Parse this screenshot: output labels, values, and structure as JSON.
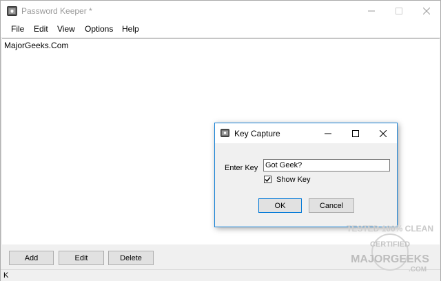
{
  "window": {
    "title": "Password Keeper *"
  },
  "menu": [
    "File",
    "Edit",
    "View",
    "Options",
    "Help"
  ],
  "text_area": {
    "content": "MajorGeeks.Com"
  },
  "bottom_buttons": {
    "add": "Add",
    "edit": "Edit",
    "delete": "Delete"
  },
  "status_bar": {
    "text": "K"
  },
  "dialog": {
    "title": "Key Capture",
    "enter_key_label": "Enter Key",
    "key_value": "Got Geek?",
    "show_key_label": "Show Key",
    "show_key_checked": true,
    "ok_label": "OK",
    "cancel_label": "Cancel"
  },
  "watermark": {
    "line1": "TESTED 100% CLEAN",
    "line2": "CERTIFIED",
    "line3": "MAJORGEEKS",
    "line4": ".COM"
  },
  "colors": {
    "dialog_border": "#1883d7",
    "button_face": "#e1e1e1",
    "window_bg": "#f0f0f0"
  }
}
